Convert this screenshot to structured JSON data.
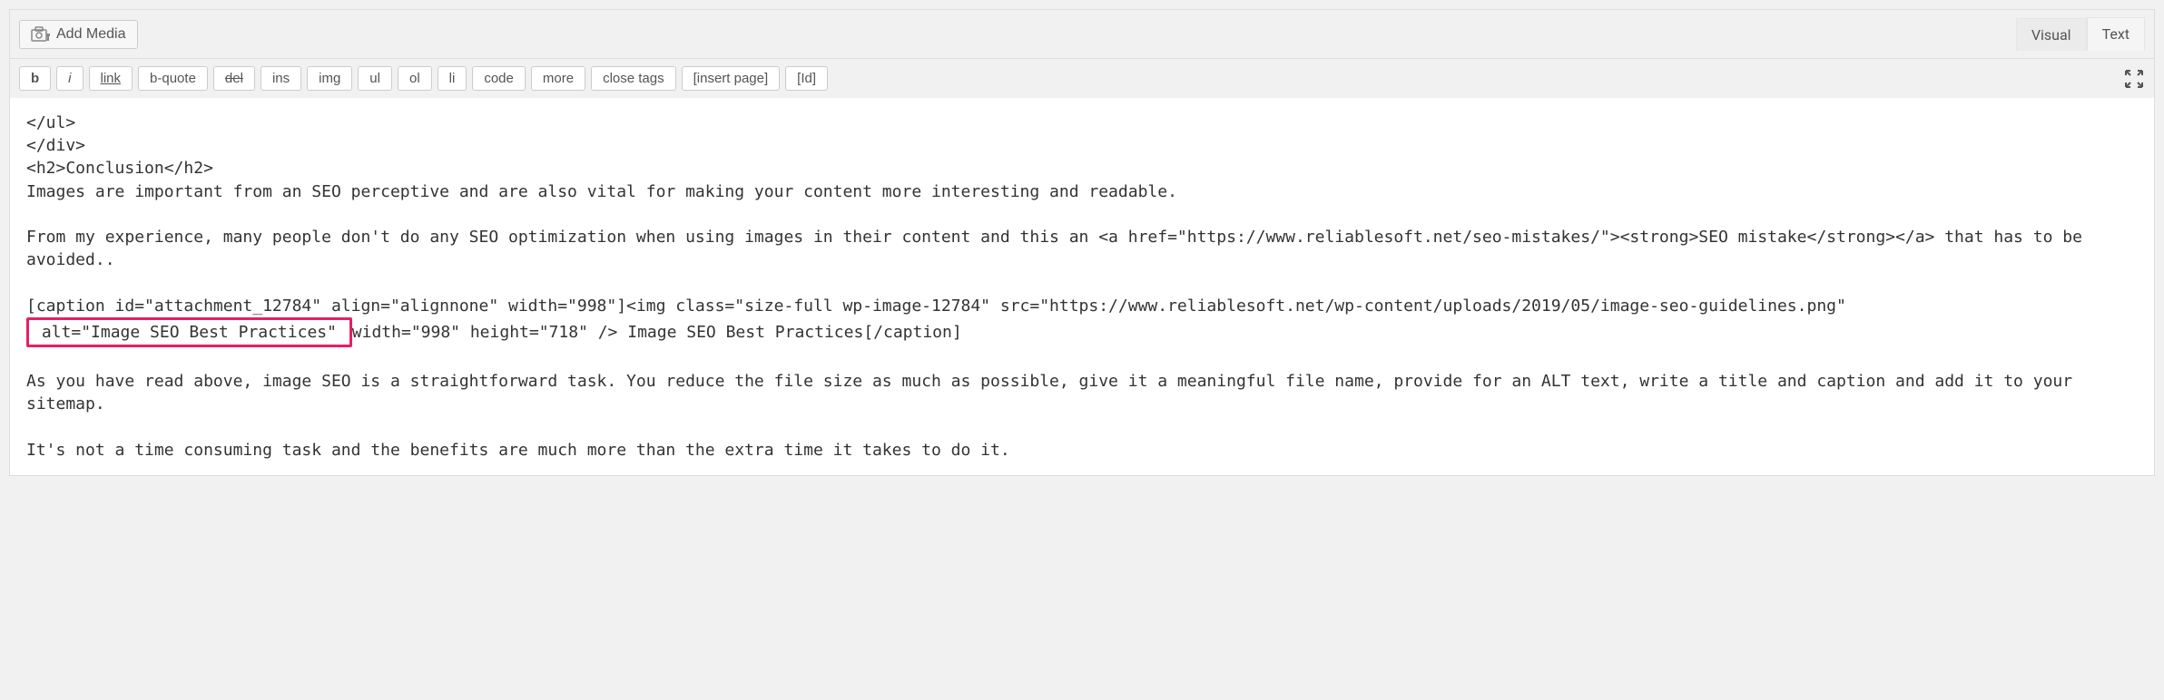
{
  "addMedia": {
    "label": "Add Media"
  },
  "tabs": {
    "visual": "Visual",
    "text": "Text"
  },
  "quicktags": {
    "b": "b",
    "i": "i",
    "link": "link",
    "bquote": "b-quote",
    "del": "del",
    "ins": "ins",
    "img": "img",
    "ul": "ul",
    "ol": "ol",
    "li": "li",
    "code": "code",
    "more": "more",
    "closeTags": "close tags",
    "insertPage": "[insert page]",
    "id": "[Id]"
  },
  "content": {
    "line1": "</ul>",
    "line2": "</div>",
    "line3": "<h2>Conclusion</h2>",
    "line4": "Images are important from an SEO perceptive and are also vital for making your content more interesting and readable.",
    "line5": "",
    "line6": "From my experience, many people don't do any SEO optimization when using images in their content and this an <a href=\"https://www.reliablesoft.net/seo-mistakes/\"><strong>SEO mistake</strong></a> that has to be avoided..",
    "line7": "",
    "line8a": "[caption id=\"attachment_12784\" align=\"alignnone\" width=\"998\"]<img class=\"size-full wp-image-12784\" src=\"https://www.reliablesoft.net/wp-content/uploads/2019/05/image-seo-guidelines.png\"",
    "line8highlight": " alt=\"Image SEO Best Practices\" ",
    "line8b": "width=\"998\" height=\"718\" /> Image SEO Best Practices[/caption]",
    "line9": "",
    "line10": "As you have read above, image SEO is a straightforward task. You reduce the file size as much as possible, give it a meaningful file name, provide for an ALT text, write a title and caption and add it to your sitemap.",
    "line11": "",
    "line12": "It's not a time consuming task and the benefits are much more than the extra time it takes to do it."
  }
}
